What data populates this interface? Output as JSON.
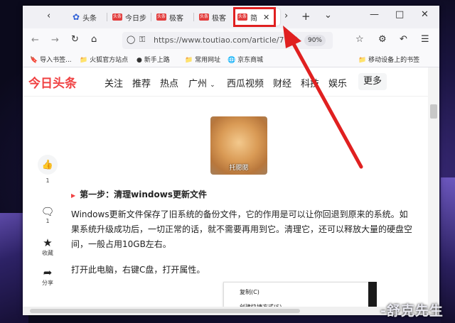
{
  "tabs": [
    {
      "label": "头条",
      "icon": "paw-icon"
    },
    {
      "label": "今日步",
      "icon": "toutiao-icon"
    },
    {
      "label": "极客",
      "icon": "toutiao-icon"
    },
    {
      "label": "极客",
      "icon": "toutiao-icon"
    },
    {
      "label": "简",
      "icon": "toutiao-icon",
      "active": true
    }
  ],
  "favicon_text": "头条",
  "address_bar": {
    "url": "https://www.toutiao.com/article/7",
    "zoom": "90%"
  },
  "bookmarks": [
    "导入书签...",
    "火狐官方站点",
    "新手上路",
    "常用网址",
    "京东商城",
    "移动设备上的书签"
  ],
  "site": {
    "logo": "今日头条",
    "nav": [
      "关注",
      "推荐",
      "热点",
      "广州",
      "西瓜视频",
      "财经",
      "科技",
      "娱乐"
    ],
    "more": "更多"
  },
  "actions": [
    {
      "name": "like",
      "count": "1",
      "icon": "thumbs-up-icon"
    },
    {
      "name": "comment",
      "count": "1",
      "icon": "comment-icon"
    },
    {
      "name": "favorite",
      "label": "收藏",
      "icon": "star-icon"
    },
    {
      "name": "share",
      "label": "分享",
      "icon": "share-icon"
    }
  ],
  "article": {
    "image_caption": "托腮腮",
    "step_title": "第一步：清理windows更新文件",
    "paragraph1": "Windows更新文件保存了旧系统的备份文件，它的作用是可以让你回退到原来的系统。如果系统升级成功后，一切正常的话，就不需要再用到它。清理它，还可以释放大量的硬盘空间，一般占用10GB左右。",
    "paragraph2": "打开此电脑，右键C盘，打开属性。"
  },
  "context_menu": [
    "复制(C)",
    "创建快捷方式(S)"
  ],
  "watermark": "-舒克先生",
  "colors": {
    "accent": "#f04142",
    "highlight": "#e02020"
  }
}
